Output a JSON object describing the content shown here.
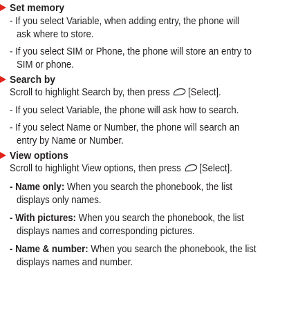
{
  "set_memory": {
    "heading": "Set memory",
    "items": [
      {
        "lines": [
          "- If you select Variable, when adding entry, the phone will",
          "ask where to store."
        ]
      },
      {
        "lines": [
          "- If you select SIM or Phone, the phone will store an entry to",
          "SIM or phone."
        ]
      }
    ]
  },
  "search_by": {
    "heading": "Search by",
    "intro_before": "Scroll to highlight Search by, then press",
    "intro_after": "[Select].",
    "items": [
      {
        "lines": [
          "- If you select Variable, the phone will ask how to search."
        ]
      },
      {
        "lines": [
          "- If you select Name or Number, the phone will search an",
          "entry by Name or Number."
        ]
      }
    ]
  },
  "view_options": {
    "heading": "View options",
    "intro_before": "Scroll to highlight View options, then press",
    "intro_after": "[Select].",
    "items": [
      {
        "term": "- Name only:",
        "rest": "When you search the phonebook, the list",
        "cont": "displays only names."
      },
      {
        "term": "- With pictures:",
        "rest": "When you search the phonebook, the list",
        "cont": "displays names and corresponding pictures."
      },
      {
        "term": "- Name & number:",
        "rest": "When you search the phonebook, the list",
        "cont": "displays names and number."
      }
    ]
  },
  "colors": {
    "text": "#231f20",
    "bullet_triangle": "#e2231a"
  },
  "icons": {
    "select_key": "soft-key-icon"
  }
}
